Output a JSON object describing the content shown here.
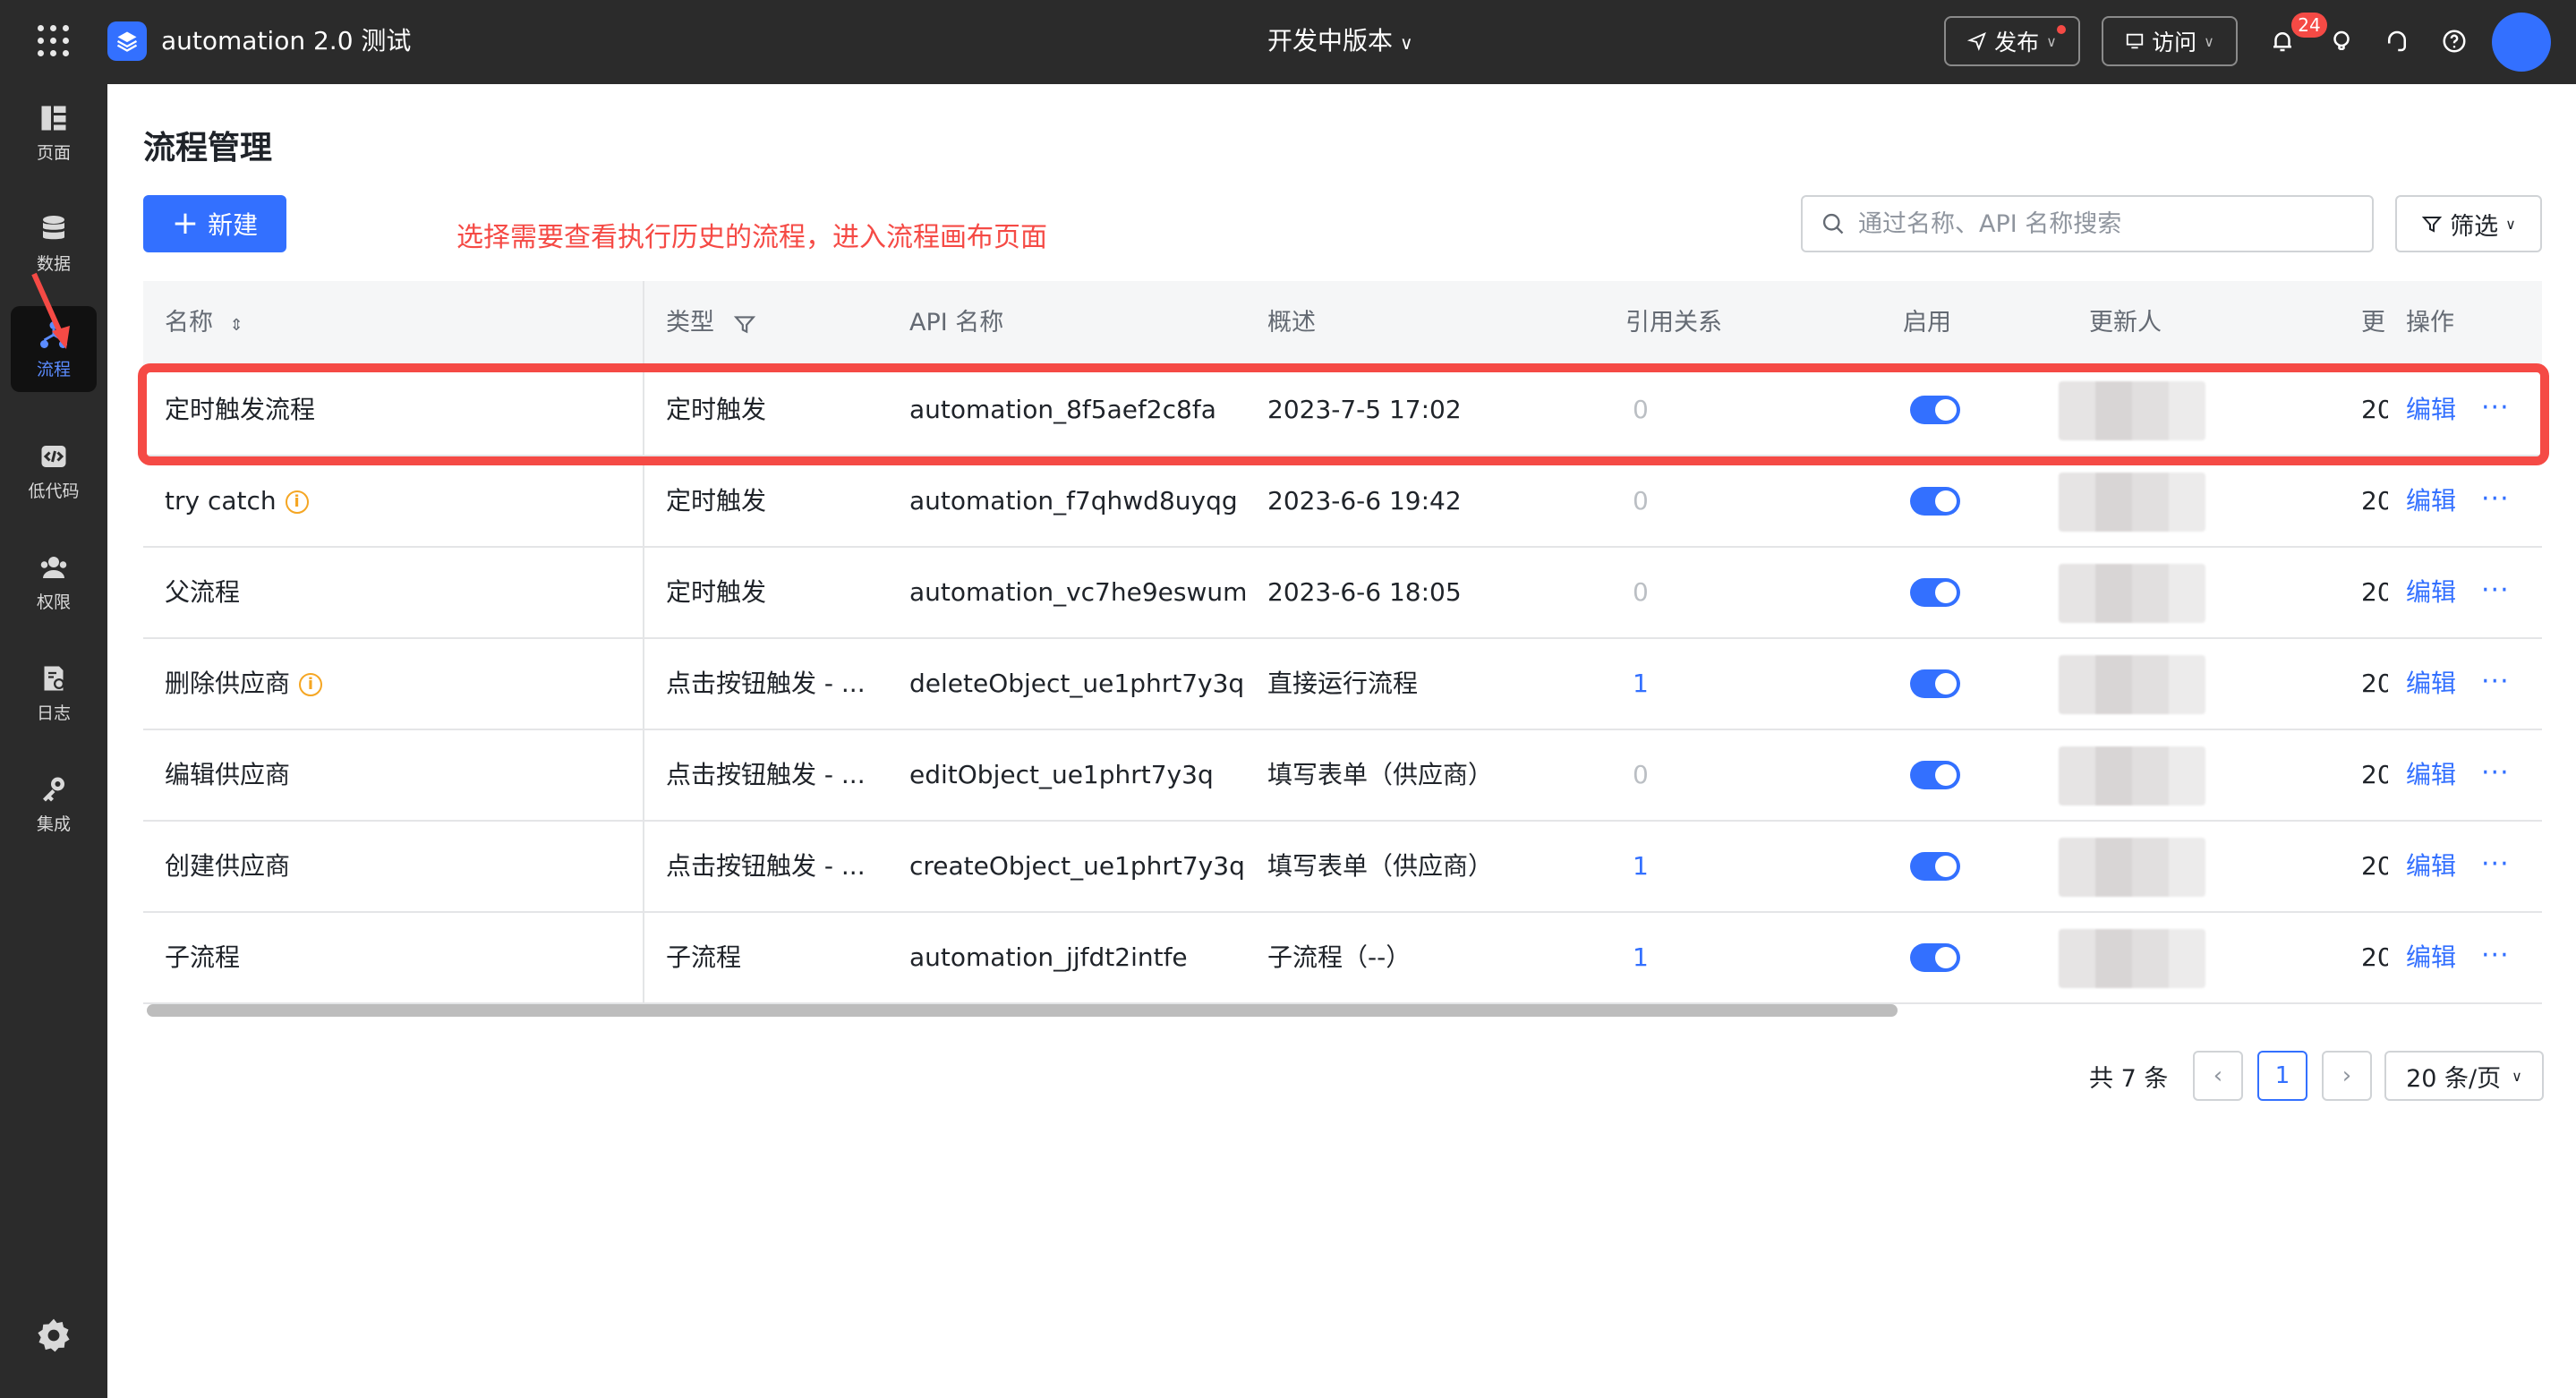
{
  "header": {
    "app_title": "automation 2.0 测试",
    "version_label": "开发中版本",
    "publish_label": "发布",
    "visit_label": "访问",
    "notification_count": "24",
    "accent_color": "#3370ff"
  },
  "sidebar": {
    "items": [
      {
        "label": "页面",
        "icon": "layout-icon"
      },
      {
        "label": "数据",
        "icon": "database-icon"
      },
      {
        "label": "流程",
        "icon": "workflow-icon",
        "active": true
      },
      {
        "label": "低代码",
        "icon": "code-icon"
      },
      {
        "label": "权限",
        "icon": "users-icon"
      },
      {
        "label": "日志",
        "icon": "log-icon"
      },
      {
        "label": "集成",
        "icon": "key-icon"
      }
    ]
  },
  "main": {
    "page_title": "流程管理",
    "new_button": "新建",
    "annotation": "选择需要查看执行历史的流程，进入流程画布页面",
    "search_placeholder": "通过名称、API 名称搜索",
    "filter_label": "筛选"
  },
  "table": {
    "headers": {
      "name": "名称",
      "type": "类型",
      "api": "API 名称",
      "summary": "概述",
      "refs": "引用关系",
      "enabled": "启用",
      "updater": "更新人",
      "updated": "更",
      "actions": "操作"
    },
    "rows": [
      {
        "name": "定时触发流程",
        "info": false,
        "type": "定时触发",
        "api": "automation_8f5aef2c8fa",
        "summary": "2023-7-5 17:02",
        "refs": "0",
        "enabled": true,
        "updated": "20",
        "edit": "编辑",
        "more": "···"
      },
      {
        "name": "try catch",
        "info": true,
        "type": "定时触发",
        "api": "automation_f7qhwd8uyqg",
        "summary": "2023-6-6 19:42",
        "refs": "0",
        "enabled": true,
        "updated": "20",
        "edit": "编辑",
        "more": "···"
      },
      {
        "name": "父流程",
        "info": false,
        "type": "定时触发",
        "api": "automation_vc7he9eswum",
        "summary": "2023-6-6 18:05",
        "refs": "0",
        "enabled": true,
        "updated": "20",
        "edit": "编辑",
        "more": "···"
      },
      {
        "name": "删除供应商",
        "info": true,
        "type": "点击按钮触发 - ...",
        "api": "deleteObject_ue1phrt7y3q",
        "summary": "直接运行流程",
        "refs": "1",
        "enabled": true,
        "updated": "20",
        "edit": "编辑",
        "more": "···"
      },
      {
        "name": "编辑供应商",
        "info": false,
        "type": "点击按钮触发 - ...",
        "api": "editObject_ue1phrt7y3q",
        "summary": "填写表单（供应商）",
        "refs": "0",
        "enabled": true,
        "updated": "20",
        "edit": "编辑",
        "more": "···"
      },
      {
        "name": "创建供应商",
        "info": false,
        "type": "点击按钮触发 - ...",
        "api": "createObject_ue1phrt7y3q",
        "summary": "填写表单（供应商）",
        "refs": "1",
        "enabled": true,
        "updated": "20",
        "edit": "编辑",
        "more": "···"
      },
      {
        "name": "子流程",
        "info": false,
        "type": "子流程",
        "api": "automation_jjfdt2intfe",
        "summary": "子流程（--）",
        "refs": "1",
        "enabled": true,
        "updated": "20",
        "edit": "编辑",
        "more": "···"
      }
    ]
  },
  "pagination": {
    "total_label": "共 7 条",
    "current_page": "1",
    "page_size_label": "20 条/页"
  }
}
